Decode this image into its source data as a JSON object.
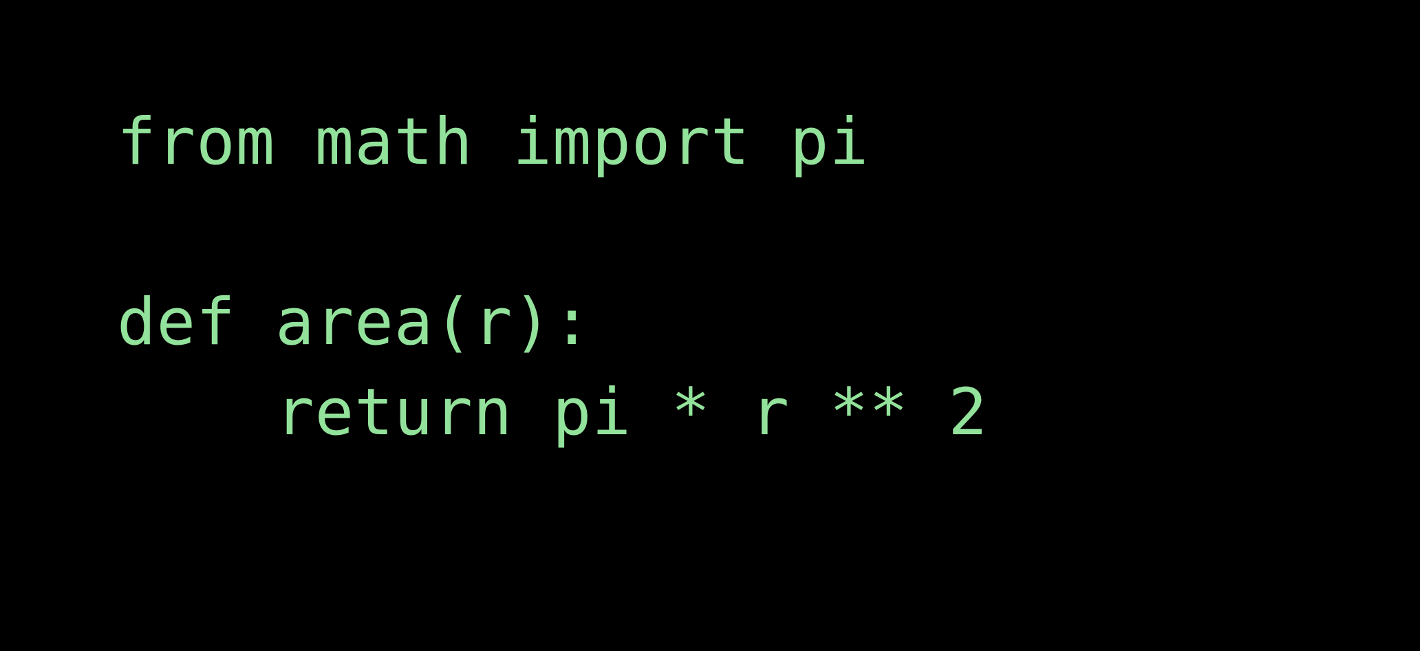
{
  "code": {
    "lines": [
      "from math import pi",
      "",
      "def area(r):",
      "    return pi * r ** 2"
    ]
  }
}
